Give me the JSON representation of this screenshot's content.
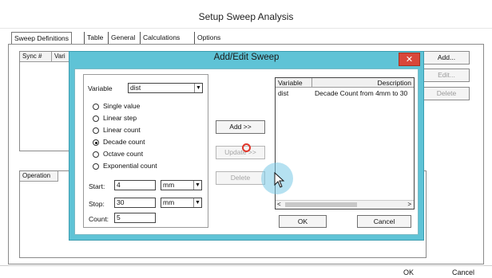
{
  "window": {
    "title": "Setup Sweep Analysis"
  },
  "tabs": [
    "Sweep Definitions",
    "Table",
    "General",
    "Calculations",
    "Options"
  ],
  "upper_table": {
    "columns": [
      "Sync #",
      "Vari"
    ]
  },
  "lower_table": {
    "columns": [
      "Operation"
    ]
  },
  "side_buttons": {
    "add": "Add...",
    "edit": "Edit...",
    "delete": "Delete"
  },
  "bottom_buttons": {
    "ok": "OK",
    "cancel": "Cancel"
  },
  "dialog": {
    "title": "Add/Edit Sweep",
    "close": "✕",
    "variable_label": "Variable",
    "variable_value": "dist",
    "radio_options": [
      {
        "label": "Single value",
        "checked": false
      },
      {
        "label": "Linear step",
        "checked": false
      },
      {
        "label": "Linear count",
        "checked": false
      },
      {
        "label": "Decade count",
        "checked": true
      },
      {
        "label": "Octave count",
        "checked": false
      },
      {
        "label": "Exponential count",
        "checked": false
      }
    ],
    "start": {
      "label": "Start:",
      "value": "4",
      "unit": "mm"
    },
    "stop": {
      "label": "Stop:",
      "value": "30",
      "unit": "mm"
    },
    "count": {
      "label": "Count:",
      "value": "5"
    },
    "mid_buttons": {
      "add": "Add >>",
      "update": "Update >>",
      "delete": "Delete"
    },
    "list": {
      "columns": [
        "Variable",
        "Description"
      ],
      "rows": [
        {
          "variable": "dist",
          "description": "Decade Count from 4mm to 30"
        }
      ]
    },
    "ok": "OK",
    "cancel": "Cancel"
  },
  "colors": {
    "dialog_frame": "#5fc3d6",
    "close_button": "#d9473a"
  }
}
